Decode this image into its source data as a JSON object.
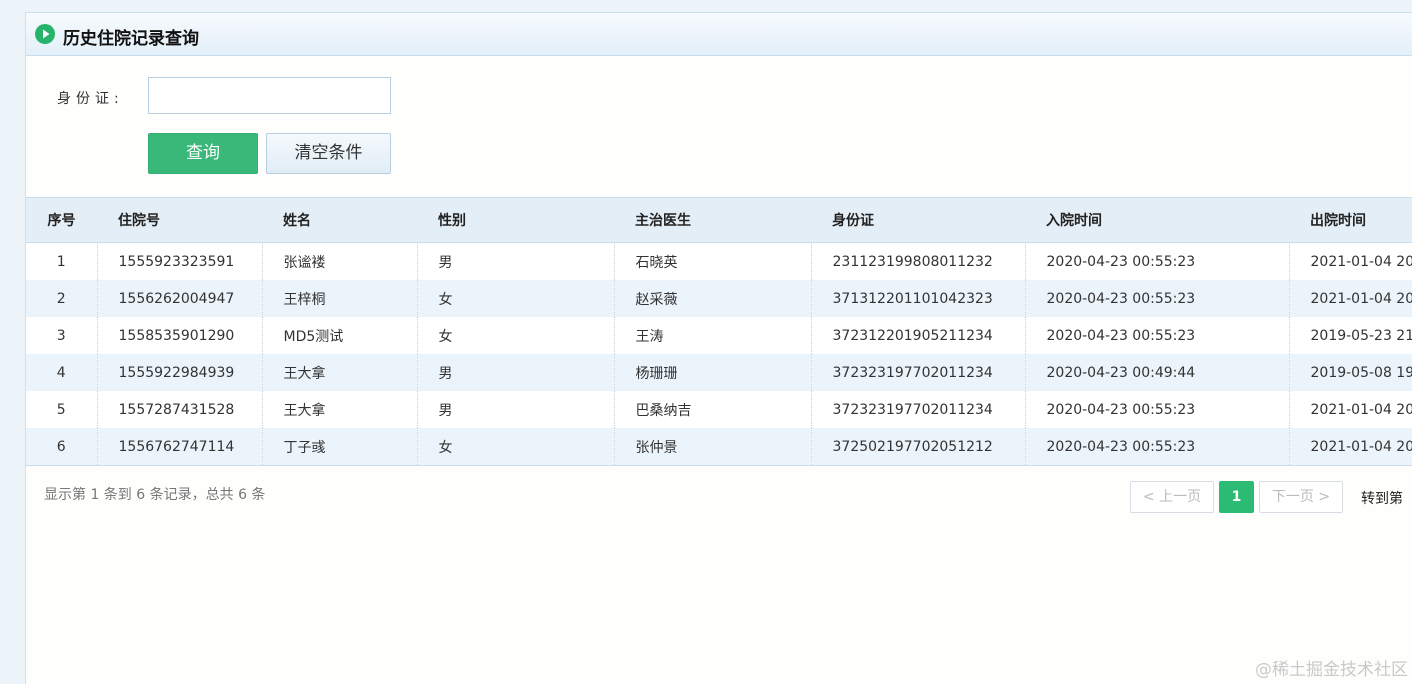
{
  "panel": {
    "title": "历史住院记录查询"
  },
  "form": {
    "id_label": "身份证:",
    "id_value": "",
    "search_label": "查询",
    "clear_label": "清空条件"
  },
  "table": {
    "headers": [
      "序号",
      "住院号",
      "姓名",
      "性别",
      "主治医生",
      "身份证",
      "入院时间",
      "出院时间"
    ],
    "rows": [
      [
        "1",
        "1555923323591",
        "张谧褛",
        "男",
        "石晓英",
        "231123199808011232",
        "2020-04-23 00:55:23",
        "2021-01-04 20"
      ],
      [
        "2",
        "1556262004947",
        "王梓桐",
        "女",
        "赵采薇",
        "371312201101042323",
        "2020-04-23 00:55:23",
        "2021-01-04 20"
      ],
      [
        "3",
        "1558535901290",
        "MD5测试",
        "女",
        "王涛",
        "372312201905211234",
        "2020-04-23 00:55:23",
        "2019-05-23 21"
      ],
      [
        "4",
        "1555922984939",
        "王大拿",
        "男",
        "杨珊珊",
        "372323197702011234",
        "2020-04-23 00:49:44",
        "2019-05-08 19"
      ],
      [
        "5",
        "1557287431528",
        "王大拿",
        "男",
        "巴桑纳吉",
        "372323197702011234",
        "2020-04-23 00:55:23",
        "2021-01-04 20"
      ],
      [
        "6",
        "1556762747114",
        "丁子彧",
        "女",
        "张仲景",
        "372502197702051212",
        "2020-04-23 00:55:23",
        "2021-01-04 20"
      ]
    ]
  },
  "pagination": {
    "summary": "显示第 1 条到 6 条记录，总共 6 条",
    "prev_label": "< 上一页",
    "current_page": "1",
    "next_label": "下一页 >",
    "goto_label": "转到第"
  },
  "watermark": "@稀土掘金技术社区",
  "colors": {
    "accent_green": "#3ab87a",
    "page_active": "#2bbb73",
    "header_bg": "#e3eef7",
    "row_alt": "#ebf4fb"
  },
  "icons": {
    "title_icon": "play-circle-icon"
  }
}
